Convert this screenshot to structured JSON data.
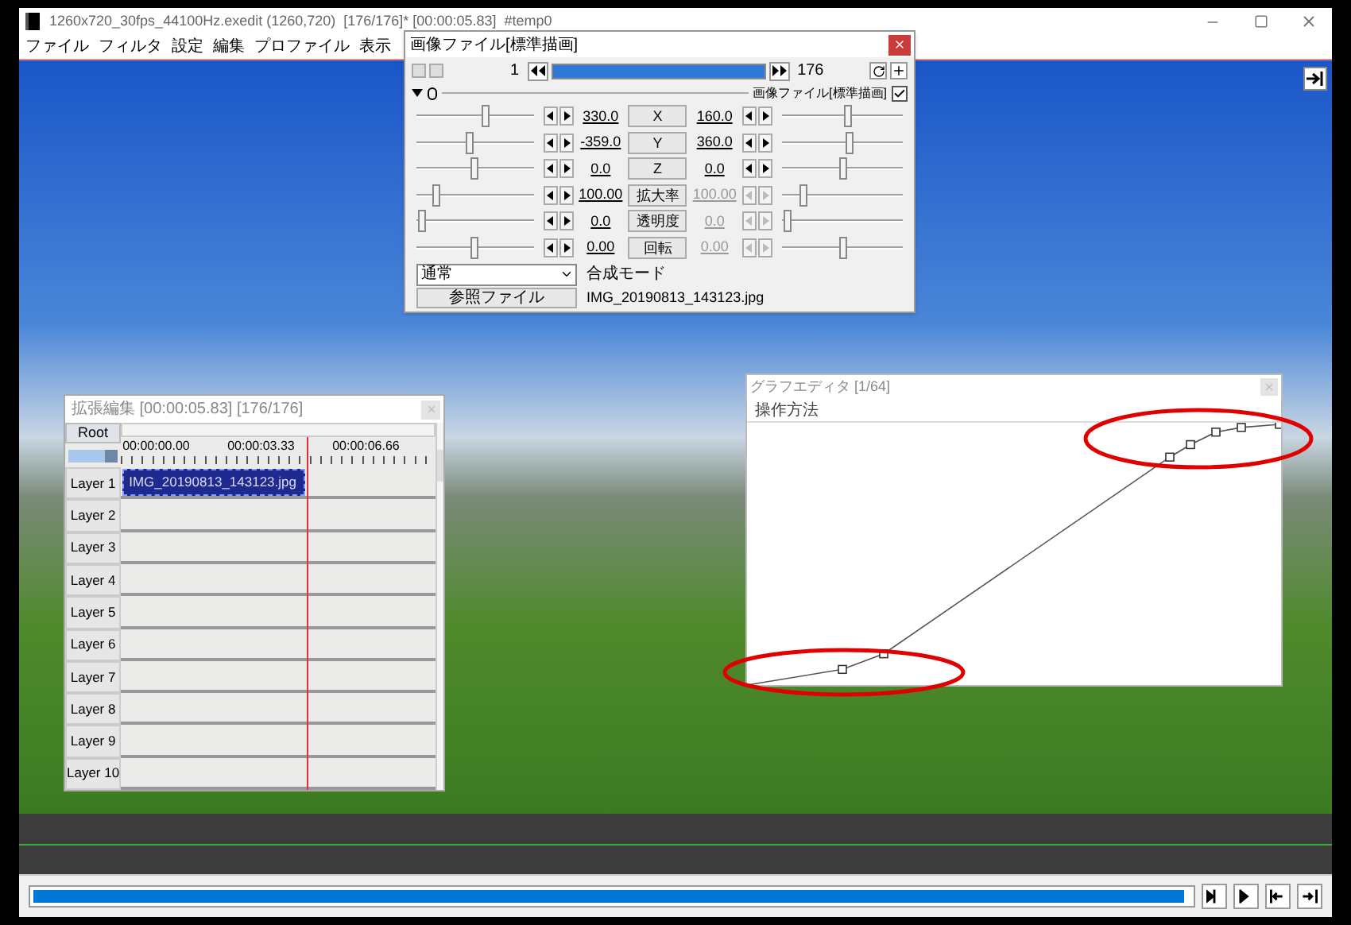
{
  "window": {
    "title": "1260x720_30fps_44100Hz.exedit (1260,720)  [176/176]* [00:00:05.83]  #temp0"
  },
  "menu": [
    "ファイル",
    "フィルタ",
    "設定",
    "編集",
    "プロファイル",
    "表示"
  ],
  "properties": {
    "title": "画像ファイル[標準描画]",
    "frame_start": "1",
    "frame_end": "176",
    "frame_slider": {
      "level": 1.0
    },
    "object_label": "画像ファイル[標準描画]",
    "object_checked": true,
    "rows": [
      {
        "left_slider": {
          "level": 0.6
        },
        "left_value": "330.0",
        "label": "X",
        "right_value": "160.0",
        "right_disabled": false,
        "right_slider": {
          "level": 0.55
        }
      },
      {
        "left_slider": {
          "level": 0.45
        },
        "left_value": "-359.0",
        "label": "Y",
        "right_value": "360.0",
        "right_disabled": false,
        "right_slider": {
          "level": 0.57
        }
      },
      {
        "left_slider": {
          "level": 0.5
        },
        "left_value": "0.0",
        "label": "Z",
        "right_value": "0.0",
        "right_disabled": false,
        "right_slider": {
          "level": 0.5
        }
      },
      {
        "left_slider": {
          "level": 0.14
        },
        "left_value": "100.00",
        "label": "拡大率",
        "right_value": "100.00",
        "right_disabled": true,
        "right_slider": {
          "level": 0.15
        }
      },
      {
        "left_slider": {
          "level": 0.02
        },
        "left_value": "0.0",
        "label": "透明度",
        "right_value": "0.0",
        "right_disabled": true,
        "right_slider": {
          "level": 0.02
        }
      },
      {
        "left_slider": {
          "level": 0.5
        },
        "left_value": "0.00",
        "label": "回転",
        "right_value": "0.00",
        "right_disabled": true,
        "right_slider": {
          "level": 0.5
        }
      }
    ],
    "blend_value": "通常",
    "blend_label": "合成モード",
    "reference_button": "参照ファイル",
    "reference_file": "IMG_20190813_143123.jpg"
  },
  "timeline": {
    "title": "拡張編集 [00:00:05.83] [176/176]",
    "root": "Root",
    "ticks": [
      "00:00:00.00",
      "00:00:03.33",
      "00:00:06.66"
    ],
    "layers": [
      {
        "name": "Layer 1",
        "clip": "IMG_20190813_143123.jpg",
        "clip_selected": true
      },
      {
        "name": "Layer 2"
      },
      {
        "name": "Layer 3"
      },
      {
        "name": "Layer 4"
      },
      {
        "name": "Layer 5"
      },
      {
        "name": "Layer 6"
      },
      {
        "name": "Layer 7"
      },
      {
        "name": "Layer 8"
      },
      {
        "name": "Layer 9"
      },
      {
        "name": "Layer 10"
      }
    ]
  },
  "graph_editor": {
    "title": "グラフエディタ [1/64]",
    "menu": "操作方法"
  },
  "seek_bar": {
    "level": 0.995
  }
}
